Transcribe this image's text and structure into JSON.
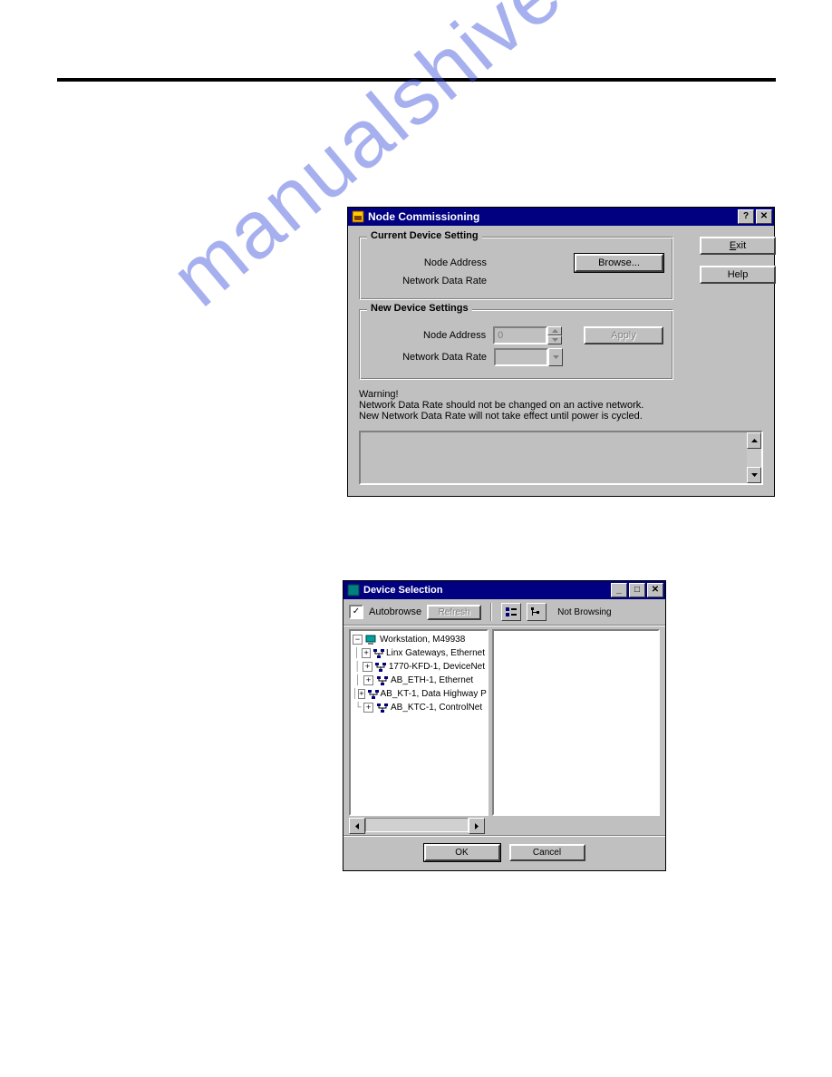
{
  "watermark": "manualshive.com",
  "dialog1": {
    "title": "Node Commissioning",
    "group_current": {
      "title": "Current Device Setting",
      "node_addr_label": "Node Address",
      "net_rate_label": "Network Data Rate",
      "browse_button": "Browse..."
    },
    "group_new": {
      "title": "New Device Settings",
      "node_addr_label": "Node Address",
      "net_rate_label": "Network Data Rate",
      "node_addr_value": "0",
      "apply_button": "Apply"
    },
    "warning_head": "Warning!",
    "warning_line1": "Network Data Rate should not be changed on an active network.",
    "warning_line2": "New Network Data Rate will not take effect until power is cycled.",
    "buttons": {
      "exit": "Exit",
      "help": "Help"
    }
  },
  "dialog2": {
    "title": "Device Selection",
    "toolbar": {
      "autobrowse_label": "Autobrowse",
      "autobrowse_checked": true,
      "refresh_button": "Refresh",
      "status": "Not Browsing"
    },
    "tree": {
      "root": "Workstation, M49938",
      "items": [
        "Linx Gateways, Ethernet",
        "1770-KFD-1, DeviceNet",
        "AB_ETH-1, Ethernet",
        "AB_KT-1, Data Highway P",
        "AB_KTC-1, ControlNet"
      ]
    },
    "buttons": {
      "ok": "OK",
      "cancel": "Cancel"
    }
  }
}
